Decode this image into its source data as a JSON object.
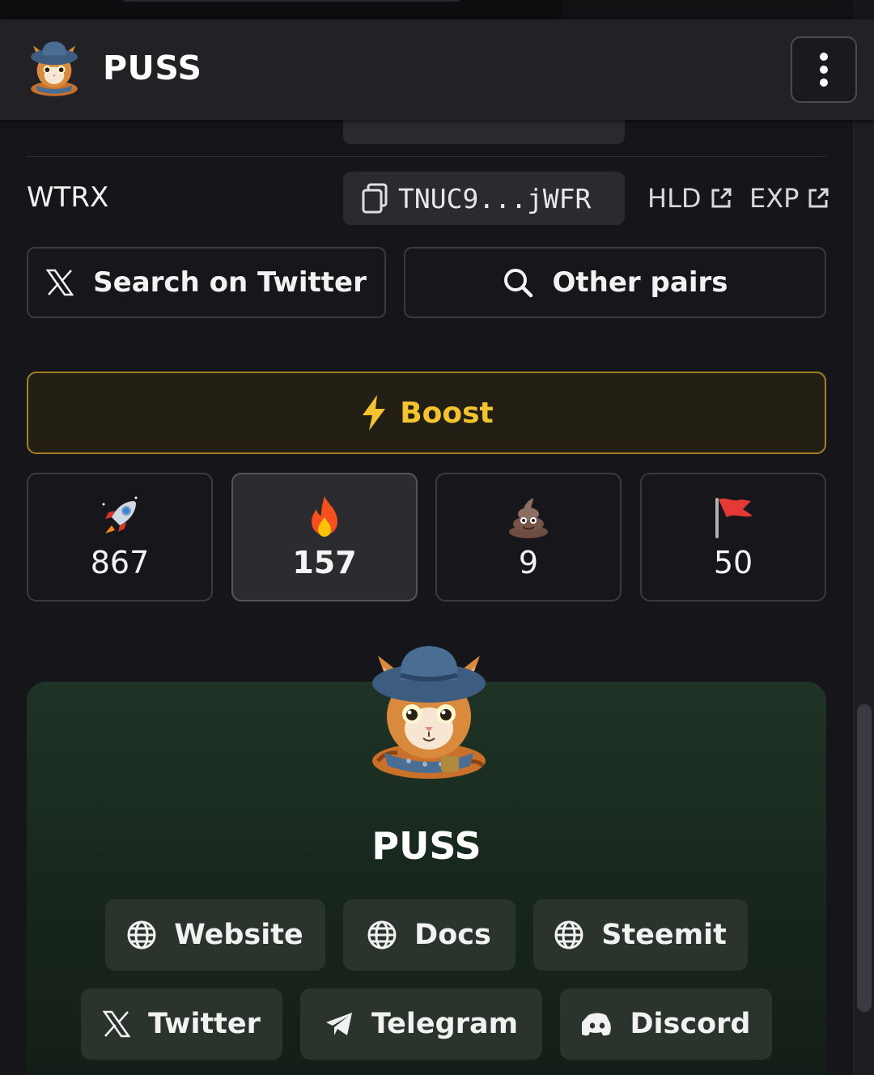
{
  "header": {
    "title": "PUSS",
    "logo_icon": "cat-with-hat-logo",
    "menu_icon": "vertical-dots-icon"
  },
  "addresses": [
    {
      "label": "WTRX",
      "address": "TNUC9...jWFR",
      "links": [
        "HLD",
        "EXP"
      ]
    }
  ],
  "actions": {
    "twitter_search": "Search on Twitter",
    "other_pairs": "Other pairs"
  },
  "boost": {
    "label": "Boost",
    "color": "#f4c430"
  },
  "reactions": [
    {
      "icon": "rocket",
      "count": "867"
    },
    {
      "icon": "fire",
      "count": "157",
      "selected": true
    },
    {
      "icon": "poop",
      "count": "9"
    },
    {
      "icon": "red-flag",
      "count": "50"
    }
  ],
  "profile": {
    "name": "PUSS",
    "links": [
      "Website",
      "Docs",
      "Steemit",
      "Twitter",
      "Telegram",
      "Discord"
    ]
  }
}
